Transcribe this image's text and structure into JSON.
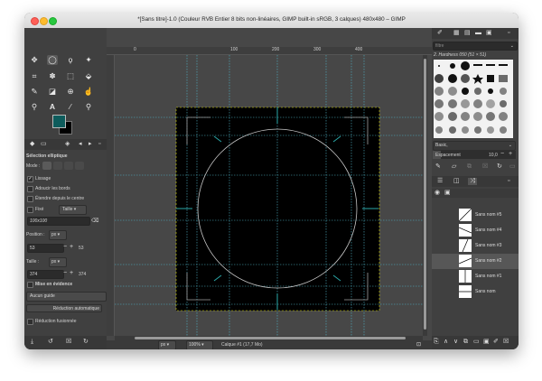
{
  "window": {
    "title": "*[Sans titre]-1.0 (Couleur RVB Entier 8 bits non-linéaires, GIMP built-in sRGB, 3 calques) 480x480 – GIMP"
  },
  "toolbox": {
    "tool_icons": [
      "move-icon",
      "ellipse-select-icon",
      "lasso-icon",
      "fuzzy-select-icon",
      "crop-icon",
      "warp-icon",
      "transform-icon",
      "bucket-fill-icon",
      "brush-icon",
      "eraser-icon",
      "clone-icon",
      "smudge-icon",
      "paths-icon",
      "text-icon",
      "color-picker-icon",
      "zoom-icon"
    ],
    "fg_color": "#0e5c5c",
    "bg_color": "#000000"
  },
  "tool_options": {
    "heading": "Sélection elliptique",
    "mode_label": "Mode :",
    "antialias": "Lissage",
    "feather": "Adoucir les bords",
    "expand": "Étendre depuis le centre",
    "fixed_label": "Fixé",
    "fixed_value": "Taille",
    "size_value": "100x100",
    "position_label": "Position :",
    "position_unit": "px",
    "pos_x": "53",
    "pos_y": "53",
    "size_label": "Taille :",
    "size_unit": "px",
    "size_w": "374",
    "size_h": "374",
    "highlight": "Mise en évidence",
    "guides": "Aucun guide",
    "auto_shrink": "Réduction automatique",
    "shrink_merged": "Réduction fusionnée"
  },
  "ruler": {
    "ticks": [
      "0",
      "100",
      "200",
      "300",
      "400"
    ]
  },
  "statusbar": {
    "unit": "px",
    "zoom": "100%",
    "info": "Calque #1 (17,7 Mo)"
  },
  "brushes": {
    "filter_placeholder": "filtre",
    "current": "2. Hardness 050 (51 × 51)",
    "preset": "Basic,",
    "spacing_label": "Espacement",
    "spacing_value": "10,0"
  },
  "layers": [
    {
      "name": "Sans nom #5"
    },
    {
      "name": "Sans nom #4"
    },
    {
      "name": "Sans nom #3"
    },
    {
      "name": "Sans nom #2"
    },
    {
      "name": "Sans nom #1"
    },
    {
      "name": "Sans nom"
    }
  ],
  "colors": {
    "guide": "#4fb5c9",
    "accent": "#2aa7a7",
    "dark_panel": "#404040"
  }
}
